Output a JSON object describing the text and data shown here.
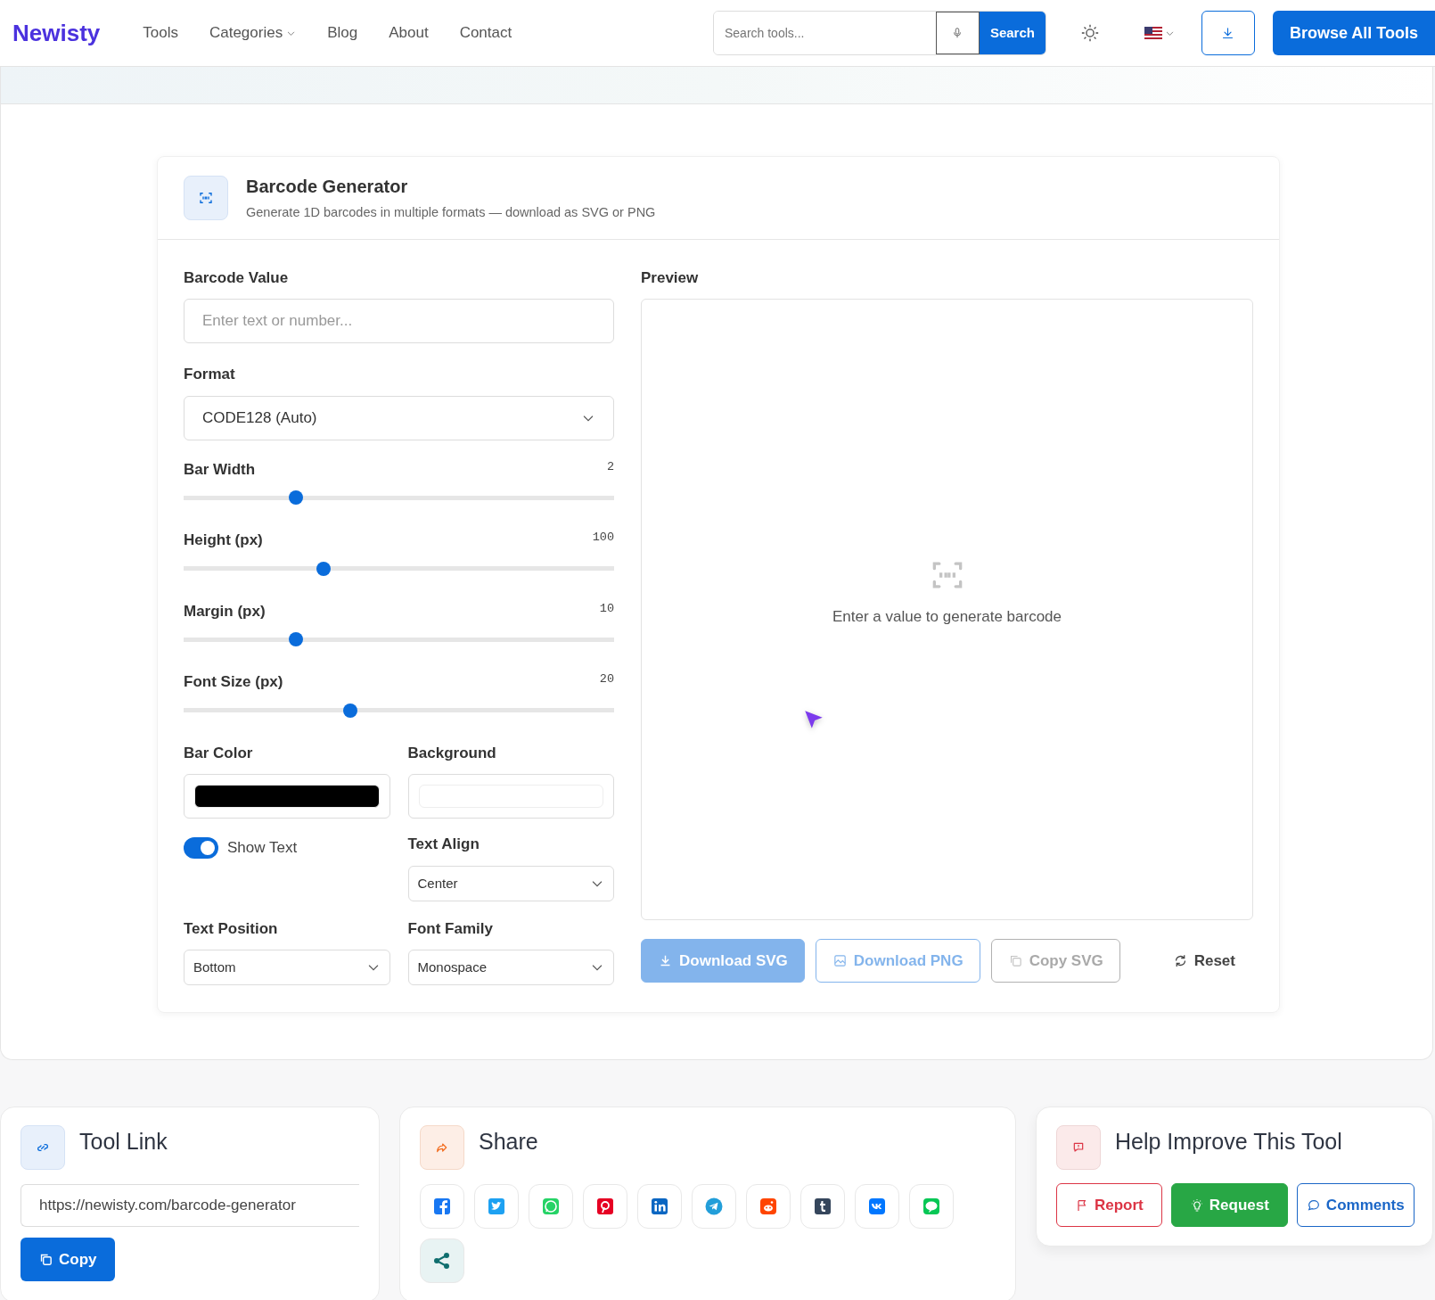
{
  "header": {
    "logo": "Newisty",
    "nav": [
      {
        "label": "Tools",
        "dropdown": false
      },
      {
        "label": "Categories",
        "dropdown": true
      },
      {
        "label": "Blog",
        "dropdown": false
      },
      {
        "label": "About",
        "dropdown": false
      },
      {
        "label": "Contact",
        "dropdown": false
      }
    ],
    "search": {
      "placeholder": "Search tools...",
      "button": "Search"
    },
    "browse_button": "Browse All Tools"
  },
  "tool": {
    "title": "Barcode Generator",
    "subtitle": "Generate 1D barcodes in multiple formats — download as SVG or PNG"
  },
  "form": {
    "value_field": {
      "label": "Barcode Value",
      "placeholder": "Enter text or number..."
    },
    "format": {
      "label": "Format",
      "value": "CODE128 (Auto)"
    },
    "sliders": [
      {
        "label": "Bar Width",
        "reading": "2",
        "level": 0.26
      },
      {
        "label": "Height (px)",
        "reading": "100",
        "level": 0.325
      },
      {
        "label": "Margin (px)",
        "reading": "10",
        "level": 0.26
      },
      {
        "label": "Font Size (px)",
        "reading": "20",
        "level": 0.388
      }
    ],
    "colors": [
      {
        "label": "Bar Color",
        "color": "#000000"
      },
      {
        "label": "Background",
        "color": "#ffffff"
      }
    ],
    "show_text": {
      "label": "Show Text",
      "on": true
    },
    "text_align": {
      "label": "Text Align",
      "value": "Center"
    },
    "text_position": {
      "label": "Text Position",
      "value": "Bottom"
    },
    "font_family": {
      "label": "Font Family",
      "value": "Monospace"
    }
  },
  "preview": {
    "label": "Preview",
    "message": "Enter a value to generate barcode"
  },
  "actions": [
    {
      "kind": "download-svg",
      "label": "Download SVG",
      "disabled": true
    },
    {
      "kind": "download-png",
      "label": "Download PNG",
      "disabled": true
    },
    {
      "kind": "copy-svg",
      "label": "Copy SVG",
      "disabled": true
    },
    {
      "kind": "reset",
      "label": "Reset",
      "disabled": false
    }
  ],
  "tool_link": {
    "title": "Tool Link",
    "url": "https://newisty.com/barcode-generator",
    "button": "Copy"
  },
  "share": {
    "title": "Share",
    "networks": [
      {
        "kind": "facebook",
        "color": "#1877f2"
      },
      {
        "kind": "twitter",
        "color": "#1da1f2"
      },
      {
        "kind": "whatsapp",
        "color": "#25d366"
      },
      {
        "kind": "pinterest",
        "color": "#e60023"
      },
      {
        "kind": "linkedin",
        "color": "#0a66c2"
      },
      {
        "kind": "telegram",
        "color": "#229ed9"
      },
      {
        "kind": "reddit",
        "color": "#ff4500"
      },
      {
        "kind": "tumblr",
        "color": "#35465c"
      },
      {
        "kind": "vk",
        "color": "#0077ff"
      },
      {
        "kind": "line",
        "color": "#06c755"
      },
      {
        "kind": "more",
        "color": "#0f6e6e"
      }
    ]
  },
  "feedback": {
    "title": "Help Improve This Tool",
    "buttons": [
      {
        "kind": "report",
        "label": "Report"
      },
      {
        "kind": "request",
        "label": "Request"
      },
      {
        "kind": "comments",
        "label": "Comments"
      }
    ]
  }
}
